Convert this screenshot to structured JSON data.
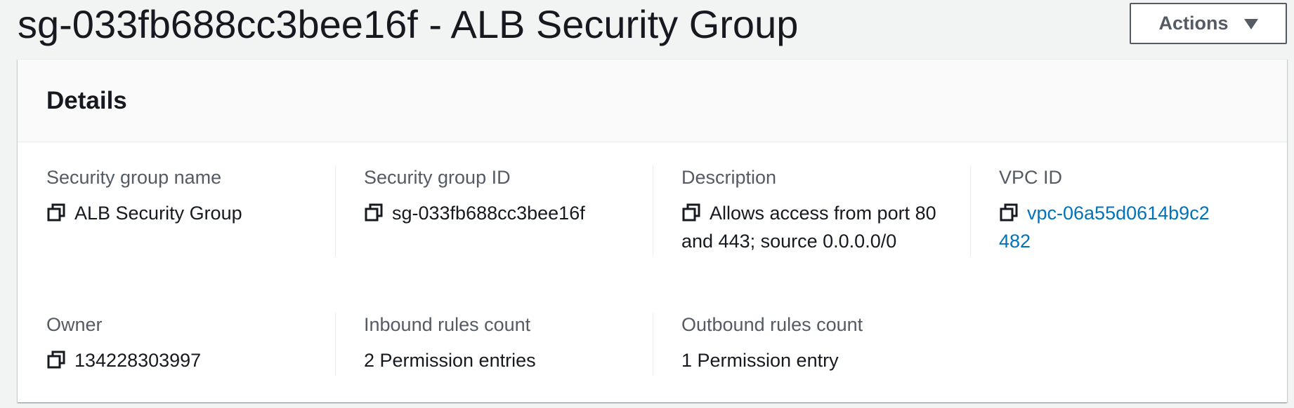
{
  "header": {
    "title": "sg-033fb688cc3bee16f - ALB Security Group",
    "actions_label": "Actions"
  },
  "details": {
    "heading": "Details",
    "fields": {
      "sg_name": {
        "label": "Security group name",
        "value": "ALB Security Group"
      },
      "sg_id": {
        "label": "Security group ID",
        "value": "sg-033fb688cc3bee16f"
      },
      "description": {
        "label": "Description",
        "value": "Allows access from port 80 and 443; source 0.0.0.0/0"
      },
      "vpc_id": {
        "label": "VPC ID",
        "value": "vpc-06a55d0614b9c2482"
      },
      "owner": {
        "label": "Owner",
        "value": "134228303997"
      },
      "inbound": {
        "label": "Inbound rules count",
        "value": "2 Permission entries"
      },
      "outbound": {
        "label": "Outbound rules count",
        "value": "1 Permission entry"
      }
    }
  },
  "icons": {
    "copy": "copy-icon",
    "caret": "caret-down-icon"
  },
  "colors": {
    "background": "#f2f3f3",
    "link": "#0073bb",
    "label": "#545b64",
    "text": "#16191f"
  }
}
